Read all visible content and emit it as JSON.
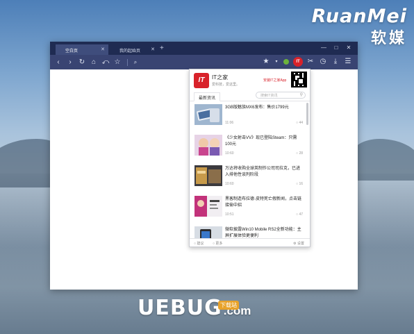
{
  "brand": {
    "en": "RuanMei",
    "cn": "软媒"
  },
  "watermark": {
    "main": "UEBUG",
    "suffix": ".com",
    "tag": "下载站"
  },
  "browser": {
    "tabs": [
      {
        "label": "空白页",
        "active": true
      },
      {
        "label": "我的起始页",
        "active": false
      }
    ],
    "new_tab": "+",
    "window_buttons": [
      "—",
      "□",
      "✕"
    ],
    "toolbar": {
      "back": "‹",
      "forward": "›",
      "refresh": "↻",
      "home": "⌂",
      "undo": "⤺",
      "bookmark": "☆",
      "search_glyph": "⌕",
      "star": "★",
      "menu_arrow": "▾",
      "ext_label": "IT",
      "scissors": "✂",
      "history": "◷",
      "download": "⤓",
      "menu": "☰"
    }
  },
  "popup": {
    "logo": "IT",
    "title": "IT之家",
    "subtitle": "爱科技，爱这里。",
    "app_link": "安装IT之家App",
    "tab_label": "最新资讯",
    "search_placeholder": "搜索IT资讯",
    "news": [
      {
        "title": "3GB版魅族MX6发布：售价1799元",
        "time": "11:06",
        "comments": "44"
      },
      {
        "title": "《少女射击VV》现已登陆Steam：只需100元",
        "time": "10:60",
        "comments": "28"
      },
      {
        "title": "万达将收购全球英制作公司司拉克，已进入排他性谈判阶段",
        "time": "10:60",
        "comments": "16"
      },
      {
        "title": "黑客制造布拉德·皮特死亡假新闻，点击链接偷中招",
        "time": "10:51",
        "comments": "47"
      },
      {
        "title": "微软披露Win10 Mobile RS2全新功能：主屏扩展体验更便利",
        "time": "",
        "comments": ""
      }
    ],
    "footer": {
      "left": "建议",
      "middle": "更多",
      "right": "设置"
    }
  }
}
